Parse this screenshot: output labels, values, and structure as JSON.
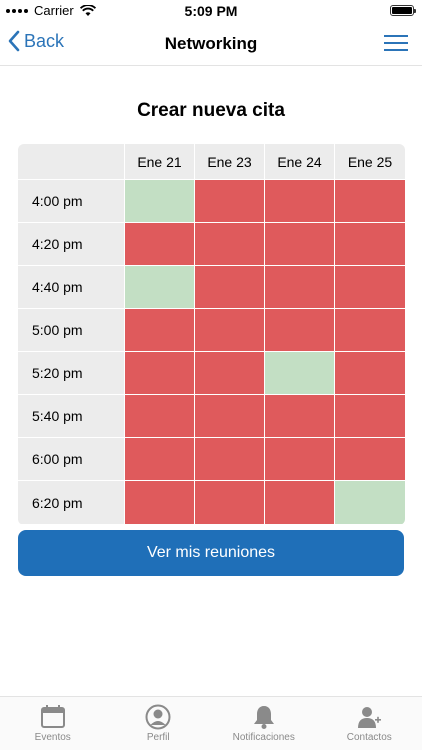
{
  "status_bar": {
    "carrier": "Carrier",
    "time": "5:09 PM"
  },
  "nav": {
    "back_label": "Back",
    "title": "Networking"
  },
  "page": {
    "title": "Crear nueva cita"
  },
  "schedule": {
    "dates": [
      "Ene 21",
      "Ene 23",
      "Ene 24",
      "Ene 25"
    ],
    "rows": [
      {
        "time": "4:00 pm",
        "slots": [
          "available",
          "busy",
          "busy",
          "busy"
        ]
      },
      {
        "time": "4:20 pm",
        "slots": [
          "busy",
          "busy",
          "busy",
          "busy"
        ]
      },
      {
        "time": "4:40 pm",
        "slots": [
          "available",
          "busy",
          "busy",
          "busy"
        ]
      },
      {
        "time": "5:00 pm",
        "slots": [
          "busy",
          "busy",
          "busy",
          "busy"
        ]
      },
      {
        "time": "5:20 pm",
        "slots": [
          "busy",
          "busy",
          "available",
          "busy"
        ]
      },
      {
        "time": "5:40 pm",
        "slots": [
          "busy",
          "busy",
          "busy",
          "busy"
        ]
      },
      {
        "time": "6:00 pm",
        "slots": [
          "busy",
          "busy",
          "busy",
          "busy"
        ]
      },
      {
        "time": "6:20 pm",
        "slots": [
          "busy",
          "busy",
          "busy",
          "available"
        ]
      }
    ],
    "colors": {
      "busy": "#df5a5c",
      "available": "#c3dfc4",
      "header": "#ececec"
    }
  },
  "actions": {
    "view_meetings_label": "Ver mis reuniones"
  },
  "tab_bar": {
    "items": [
      {
        "label": "Eventos",
        "icon": "calendar-icon"
      },
      {
        "label": "Perfil",
        "icon": "profile-icon"
      },
      {
        "label": "Notificaciones",
        "icon": "bell-icon"
      },
      {
        "label": "Contactos",
        "icon": "add-contact-icon"
      }
    ]
  },
  "colors": {
    "accent": "#2b74b8",
    "button": "#1f6fb8"
  }
}
